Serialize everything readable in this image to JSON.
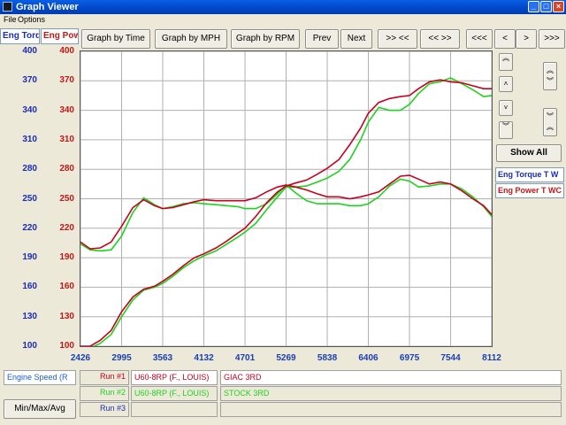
{
  "window": {
    "title": "Graph Viewer",
    "controls": {
      "minimize": "_",
      "maximize": "□",
      "close": "×"
    }
  },
  "menu": {
    "items": [
      "File",
      "Options"
    ]
  },
  "tabs": {
    "torque": "Eng Torq",
    "power": "Eng Powe"
  },
  "toolbar": {
    "by_time": "Graph by Time",
    "by_mph": "Graph by MPH",
    "by_rpm": "Graph by RPM",
    "prev": "Prev",
    "next": "Next",
    "zoom_in": ">> <<",
    "zoom_out": "<< >>",
    "pan_far_left": "<<<",
    "pan_left": "<",
    "pan_right": ">",
    "pan_far_right": ">>>"
  },
  "side_controls": {
    "scroll_up_fast": "︽",
    "scroll_up": "˄",
    "scroll_down": "˅",
    "scroll_down_fast": "︾",
    "expand": "︽\n︾",
    "compress": "︾\n︽",
    "show_all": "Show All"
  },
  "legend": {
    "torque": "Eng Torque T W",
    "power": "Eng Power T WC"
  },
  "colors": {
    "torque_axis": "#1a2db2",
    "power_axis": "#c01818",
    "run1": "#c8001e",
    "run2": "#1ed21e",
    "run3": "#1a2db2",
    "speed_label": "#1a5fd0"
  },
  "bottom": {
    "speed_field": "Engine Speed (R",
    "minmax_button": "Min/Max/Avg",
    "runs": [
      {
        "label": "Run #1",
        "vehicle": "U60-8RP (F., LOUIS)",
        "note": "GIAC 3RD"
      },
      {
        "label": "Run #2",
        "vehicle": "U60-8RP (F., LOUIS)",
        "note": "STOCK 3RD"
      },
      {
        "label": "Run #3",
        "vehicle": "",
        "note": ""
      }
    ]
  },
  "chart_data": {
    "type": "line",
    "xlabel": "",
    "ylabel": "",
    "x_ticks": [
      2426,
      2995,
      3563,
      4132,
      4701,
      5269,
      5838,
      6406,
      6975,
      7544,
      8112
    ],
    "xlim": [
      2426,
      8112
    ],
    "y_axes": {
      "torque": {
        "ticks": [
          100,
          130,
          160,
          190,
          220,
          250,
          280,
          310,
          340,
          370,
          400
        ],
        "ylim": [
          100,
          400
        ]
      },
      "power": {
        "ticks": [
          100,
          130,
          160,
          190,
          220,
          250,
          280,
          310,
          340,
          370,
          400
        ],
        "ylim": [
          100,
          400
        ]
      }
    },
    "grid": true,
    "series": [
      {
        "name": "Run #1",
        "axis": "torque",
        "x": [
          2426,
          2560,
          2700,
          2850,
          2995,
          3150,
          3300,
          3450,
          3563,
          3700,
          3850,
          4000,
          4132,
          4300,
          4450,
          4600,
          4701,
          4850,
          5000,
          5150,
          5269,
          5400,
          5550,
          5700,
          5838,
          6000,
          6150,
          6300,
          6406,
          6550,
          6700,
          6850,
          6975,
          7100,
          7250,
          7400,
          7544,
          7700,
          7850,
          8000,
          8112
        ],
        "y": [
          206,
          199,
          200,
          206,
          222,
          241,
          249,
          243,
          240,
          241,
          244,
          247,
          249,
          248,
          248,
          248,
          248,
          251,
          257,
          262,
          264,
          262,
          259,
          255,
          252,
          252,
          250,
          252,
          254,
          257,
          265,
          273,
          274,
          270,
          265,
          267,
          265,
          258,
          250,
          243,
          234
        ]
      },
      {
        "name": "Run #2",
        "axis": "torque",
        "x": [
          2426,
          2560,
          2700,
          2850,
          2995,
          3150,
          3300,
          3450,
          3563,
          3700,
          3850,
          4000,
          4132,
          4300,
          4450,
          4600,
          4701,
          4850,
          5000,
          5150,
          5269,
          5400,
          5550,
          5700,
          5838,
          6000,
          6150,
          6300,
          6406,
          6550,
          6700,
          6850,
          6975,
          7100,
          7250,
          7400,
          7544,
          7700,
          7850,
          8000,
          8112
        ],
        "y": [
          204,
          198,
          197,
          198,
          212,
          236,
          251,
          244,
          240,
          242,
          245,
          246,
          245,
          244,
          243,
          242,
          240,
          240,
          245,
          255,
          264,
          256,
          248,
          245,
          245,
          245,
          243,
          243,
          245,
          252,
          263,
          270,
          268,
          262,
          263,
          265,
          265,
          260,
          252,
          242,
          232
        ]
      },
      {
        "name": "Run #1",
        "axis": "power",
        "x": [
          2426,
          2560,
          2700,
          2850,
          2995,
          3150,
          3300,
          3450,
          3563,
          3700,
          3850,
          4000,
          4132,
          4300,
          4450,
          4600,
          4701,
          4850,
          5000,
          5150,
          5269,
          5400,
          5550,
          5700,
          5838,
          6000,
          6150,
          6300,
          6406,
          6550,
          6700,
          6850,
          6975,
          7100,
          7250,
          7400,
          7544,
          7700,
          7850,
          8000,
          8112
        ],
        "y": [
          100,
          100,
          106,
          116,
          135,
          150,
          158,
          161,
          166,
          173,
          182,
          190,
          194,
          200,
          207,
          215,
          220,
          232,
          246,
          257,
          263,
          266,
          269,
          275,
          281,
          290,
          305,
          322,
          337,
          348,
          352,
          354,
          355,
          362,
          369,
          371,
          369,
          368,
          365,
          362,
          362
        ]
      },
      {
        "name": "Run #2",
        "axis": "power",
        "x": [
          2426,
          2560,
          2700,
          2850,
          2995,
          3150,
          3300,
          3450,
          3563,
          3700,
          3850,
          4000,
          4132,
          4300,
          4450,
          4600,
          4701,
          4850,
          5000,
          5150,
          5269,
          5400,
          5550,
          5700,
          5838,
          6000,
          6150,
          6300,
          6406,
          6550,
          6700,
          6850,
          6975,
          7100,
          7250,
          7400,
          7544,
          7700,
          7850,
          8000,
          8112
        ],
        "y": [
          98,
          98,
          103,
          112,
          130,
          147,
          157,
          160,
          164,
          171,
          180,
          187,
          192,
          197,
          204,
          211,
          216,
          225,
          239,
          252,
          262,
          262,
          263,
          267,
          271,
          278,
          290,
          310,
          328,
          343,
          340,
          340,
          346,
          357,
          367,
          369,
          373,
          367,
          361,
          354,
          355
        ]
      }
    ]
  }
}
